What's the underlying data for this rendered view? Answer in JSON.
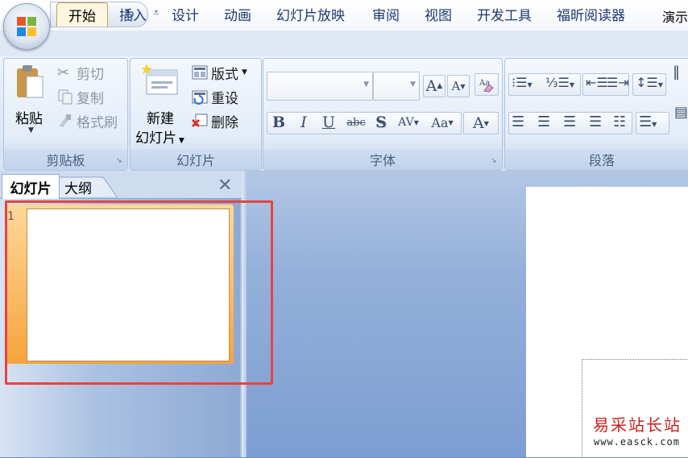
{
  "window": {
    "doc_title": "演示"
  },
  "tabs": [
    "开始",
    "插入",
    "设计",
    "动画",
    "幻灯片放映",
    "审阅",
    "视图",
    "开发工具",
    "福昕阅读器"
  ],
  "ribbon": {
    "clipboard": {
      "paste": "粘贴",
      "cut": "剪切",
      "copy": "复制",
      "format_painter": "格式刷",
      "label": "剪贴板"
    },
    "slides": {
      "new_slide_1": "新建",
      "new_slide_2": "幻灯片",
      "layout": "版式",
      "reset": "重设",
      "delete": "删除",
      "label": "幻灯片"
    },
    "font": {
      "label": "字体",
      "bold": "B",
      "italic": "I",
      "underline": "U",
      "strike": "abc",
      "shadow": "S",
      "spacing": "AV",
      "case": "Aa",
      "color": "A"
    },
    "paragraph": {
      "label": "段落"
    }
  },
  "panel": {
    "tab_slides": "幻灯片",
    "tab_outline": "大纲",
    "close": "✕",
    "slide_number": "1"
  },
  "watermark": {
    "line1": "易采站长站",
    "line2": "www.easck.com"
  },
  "colors": {
    "highlight": "#e8443d",
    "selection": "#f5a43c",
    "accent": "#1e3a6d"
  }
}
